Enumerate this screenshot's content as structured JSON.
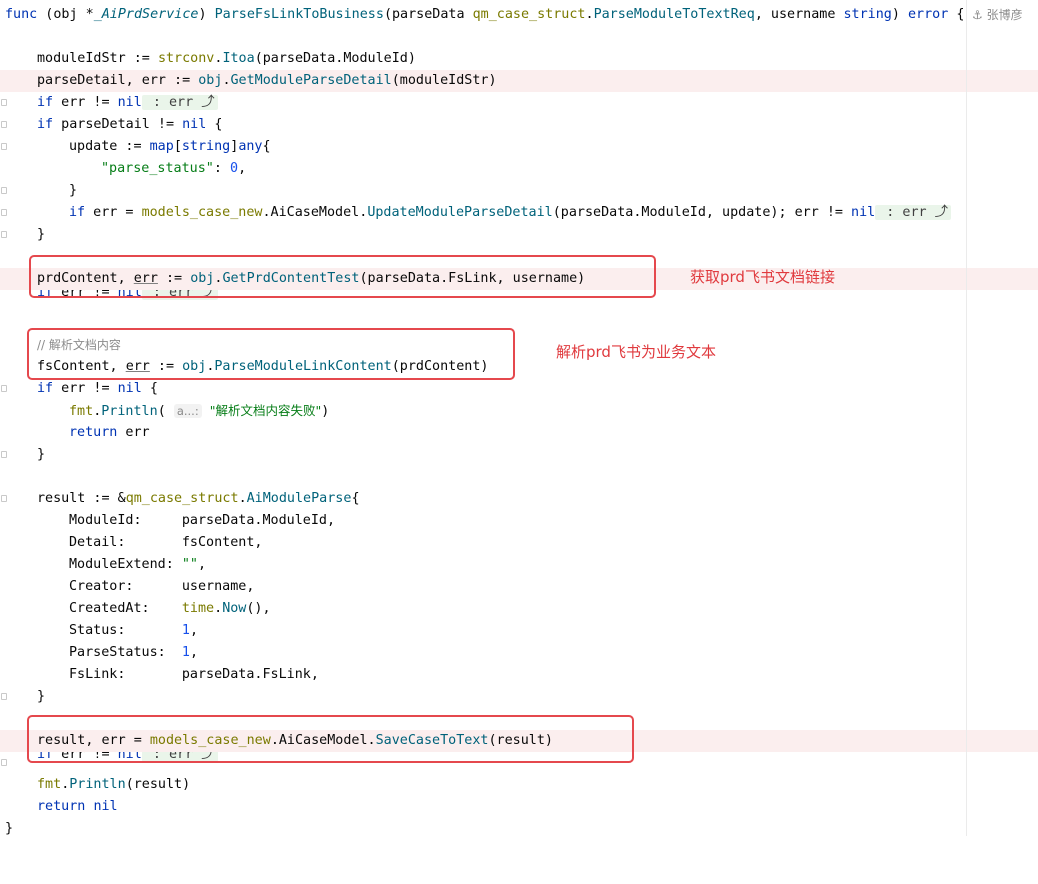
{
  "author": {
    "icon": "person-icon",
    "name": "张博彦"
  },
  "lines": {
    "l1": {
      "kw1": "func",
      "p1": " (obj *",
      "t1": "_AiPrdService",
      "p2": ") ",
      "fn": "ParseFsLinkToBusiness",
      "p3": "(parseData ",
      "pkg": "qm_case_struct",
      "dot": ".",
      "t2": "ParseModuleToTextReq",
      "p4": ", username ",
      "kw2": "string",
      "p5": ") ",
      "kw3": "error",
      "p6": " {"
    },
    "l3": {
      "a": "moduleIdStr := ",
      "pkg": "strconv",
      "b": ".",
      "fn": "Itoa",
      "c": "(parseData.ModuleId)"
    },
    "l4": {
      "a": "parseDetail, err := ",
      "obj": "obj",
      "b": ".",
      "fn": "GetModuleParseDetail",
      "c": "(moduleIdStr)"
    },
    "l5": {
      "kw": "if",
      "a": " err != ",
      "nil": "nil",
      "fold": " : err ⤴"
    },
    "l6": {
      "kw": "if",
      "a": " parseDetail != ",
      "nil": "nil",
      "b": " {"
    },
    "l7": {
      "a": "update := ",
      "kw1": "map",
      "b": "[",
      "kw2": "string",
      "c": "]",
      "kw3": "any",
      "d": "{"
    },
    "l8": {
      "str": "\"parse_status\"",
      "a": ": ",
      "num": "0",
      "b": ","
    },
    "l9": {
      "a": "}"
    },
    "l10": {
      "kw": "if",
      "a": " err = ",
      "pkg": "models_case_new",
      "b": ".AiCaseModel.",
      "fn": "UpdateModuleParseDetail",
      "c": "(parseData.ModuleId, update); err != ",
      "nil": "nil",
      "fold": " : err ⤴"
    },
    "l11": {
      "a": "}"
    },
    "l13": {
      "a": "prdContent, ",
      "err": "err",
      "b": " := ",
      "obj": "obj",
      "c": ".",
      "fn": "GetPrdContentTest",
      "d": "(parseData.FsLink, username)"
    },
    "l14": {
      "kw": "if",
      "a": " err != ",
      "nil": "nil",
      "fold": " : err ⤴"
    },
    "l16": {
      "cm": "// 解析文档内容"
    },
    "l17": {
      "a": "fsContent, ",
      "err": "err",
      "b": " := ",
      "obj": "obj",
      "c": ".",
      "fn": "ParseModuleLinkContent",
      "d": "(prdContent)"
    },
    "l18": {
      "kw": "if",
      "a": " err != ",
      "nil": "nil",
      "b": " {"
    },
    "l19": {
      "pkg": "fmt",
      "a": ".",
      "fn": "Println",
      "b": "( ",
      "hint": "a...:",
      "c": " ",
      "str": "\"解析文档内容失败\"",
      "d": ")"
    },
    "l20": {
      "kw": "return",
      "a": " err"
    },
    "l21": {
      "a": "}"
    },
    "l23": {
      "a": "result := &",
      "pkg": "qm_case_struct",
      "b": ".",
      "ty": "AiModuleParse",
      "c": "{"
    },
    "l24": {
      "k": "ModuleId:     ",
      "v": "parseData.ModuleId,"
    },
    "l25": {
      "k": "Detail:       ",
      "v": "fsContent,"
    },
    "l26": {
      "k": "ModuleExtend: ",
      "str": "\"\"",
      "v": ","
    },
    "l27": {
      "k": "Creator:      ",
      "v": "username,"
    },
    "l28": {
      "k": "CreatedAt:    ",
      "pkg": "time",
      "a": ".",
      "fn": "Now",
      "v": "(),"
    },
    "l29": {
      "k": "Status:       ",
      "num": "1",
      "v": ","
    },
    "l30": {
      "k": "ParseStatus:  ",
      "num": "1",
      "v": ","
    },
    "l31": {
      "k": "FsLink:       ",
      "v": "parseData.FsLink,"
    },
    "l32": {
      "a": "}"
    },
    "l34": {
      "a": "result, err = ",
      "pkg": "models_case_new",
      "b": ".AiCaseModel.",
      "fn": "SaveCaseToText",
      "c": "(result)"
    },
    "l35": {
      "kw": "if",
      "a": " err != ",
      "nil": "nil",
      "fold": " : err ⤴"
    },
    "l36": {
      "pkg": "fmt",
      "a": ".",
      "fn": "Println",
      "b": "(result)"
    },
    "l37": {
      "kw": "return",
      "nil": "nil"
    },
    "l38": {
      "a": "}"
    }
  },
  "annotations": {
    "note1": "获取prd飞书文档链接",
    "note2": "解析prd飞书为业务文本"
  },
  "colors": {
    "keyword": "#0033b3",
    "function": "#00627a",
    "package": "#7a7a00",
    "number": "#1750eb",
    "string": "#067d17",
    "highlight": "#fbeeee",
    "annotation": "#e5484d"
  }
}
